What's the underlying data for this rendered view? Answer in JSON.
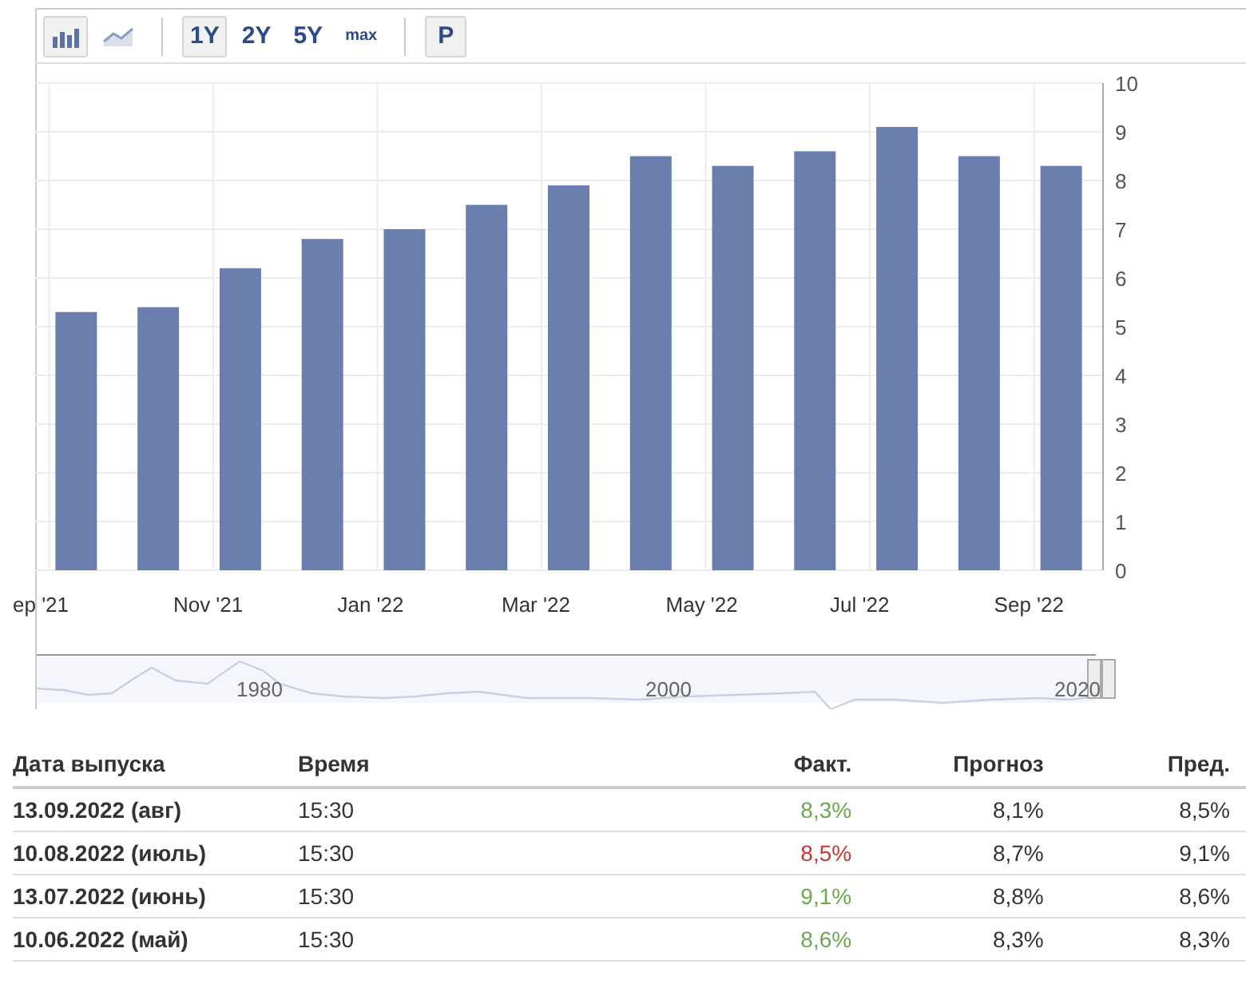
{
  "toolbar": {
    "chart_types": [
      {
        "selected": true
      },
      {
        "selected": false
      }
    ],
    "ranges": [
      {
        "label": "1Y",
        "selected": true
      },
      {
        "label": "2Y",
        "selected": false
      },
      {
        "label": "5Y",
        "selected": false
      },
      {
        "label": "max",
        "selected": false
      }
    ],
    "extra_button": "P"
  },
  "chart": {
    "chart_data": {
      "type": "bar",
      "categories": [
        "ep '21",
        null,
        "Nov '21",
        null,
        "Jan '22",
        null,
        "Mar '22",
        null,
        "May '22",
        null,
        "Jul '22",
        null,
        "Sep '22"
      ],
      "values": [
        5.3,
        5.4,
        6.2,
        6.8,
        7.0,
        7.5,
        7.9,
        8.5,
        8.3,
        8.6,
        9.1,
        8.5,
        8.3
      ],
      "ylim": [
        0,
        10
      ],
      "yticks": [
        0,
        1,
        2,
        3,
        4,
        5,
        6,
        7,
        8,
        9,
        10
      ],
      "grid": true
    }
  },
  "navigator": {
    "labels": [
      "1980",
      "2000",
      "2020"
    ]
  },
  "table": {
    "columns": [
      "Дата выпуска",
      "Время",
      "Факт.",
      "Прогноз",
      "Пред."
    ],
    "rows": [
      {
        "date": "13.09.2022 (авг)",
        "time": "15:30",
        "actual": "8,3%",
        "color": "#6aa84f",
        "forecast": "8,1%",
        "previous": "8,5%"
      },
      {
        "date": "10.08.2022 (июль)",
        "time": "15:30",
        "actual": "8,5%",
        "color": "#cc3333",
        "forecast": "8,7%",
        "previous": "9,1%"
      },
      {
        "date": "13.07.2022 (июнь)",
        "time": "15:30",
        "actual": "9,1%",
        "color": "#6aa84f",
        "forecast": "8,8%",
        "previous": "8,6%"
      },
      {
        "date": "10.06.2022 (май)",
        "time": "15:30",
        "actual": "8,6%",
        "color": "#6aa84f",
        "forecast": "8,3%",
        "previous": "8,3%"
      }
    ]
  }
}
